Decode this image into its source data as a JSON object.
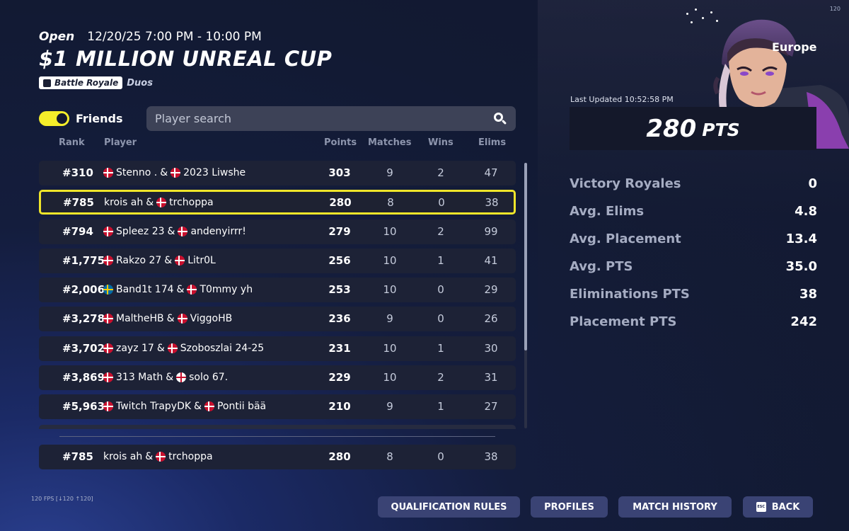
{
  "fps": {
    "top": "120",
    "bottom": "120 FPS [↓120 ↑120]"
  },
  "event": {
    "status": "Open",
    "time": "12/20/25 7:00 PM - 10:00 PM",
    "title": "$1 MILLION UNREAL CUP",
    "mode": "Battle Royale",
    "team": "Duos"
  },
  "filters": {
    "friends_label": "Friends",
    "friends_on": true,
    "search_placeholder": "Player search"
  },
  "columns": {
    "rank": "Rank",
    "player": "Player",
    "points": "Points",
    "matches": "Matches",
    "wins": "Wins",
    "elims": "Elims"
  },
  "rows": [
    {
      "rank": "#310",
      "p1": "Stenno .",
      "f1": "dk",
      "p2": "2023 Liwshe",
      "f2": "dk",
      "points": "303",
      "matches": "9",
      "wins": "2",
      "elims": "47"
    },
    {
      "rank": "#785",
      "p1": "krois ah",
      "f1": "",
      "p2": "trchoppa",
      "f2": "dk",
      "points": "280",
      "matches": "8",
      "wins": "0",
      "elims": "38",
      "highlight": true
    },
    {
      "rank": "#794",
      "p1": "Spleez 23",
      "f1": "dk",
      "p2": "andenyirrr!",
      "f2": "dk",
      "points": "279",
      "matches": "10",
      "wins": "2",
      "elims": "99"
    },
    {
      "rank": "#1,775",
      "p1": "Rakzo 27",
      "f1": "dk",
      "p2": "Litr0L",
      "f2": "dk",
      "points": "256",
      "matches": "10",
      "wins": "1",
      "elims": "41"
    },
    {
      "rank": "#2,006",
      "p1": "Band1t 174",
      "f1": "se",
      "p2": "T0mmy yh",
      "f2": "dk",
      "points": "253",
      "matches": "10",
      "wins": "0",
      "elims": "29"
    },
    {
      "rank": "#3,278",
      "p1": "MaltheHB",
      "f1": "dk",
      "p2": "ViggoHB",
      "f2": "dk",
      "points": "236",
      "matches": "9",
      "wins": "0",
      "elims": "26"
    },
    {
      "rank": "#3,702",
      "p1": "zayz 17",
      "f1": "dk",
      "p2": "Szoboszlai 24-25",
      "f2": "dk",
      "points": "231",
      "matches": "10",
      "wins": "1",
      "elims": "30"
    },
    {
      "rank": "#3,869",
      "p1": "313 Math",
      "f1": "dk",
      "p2": "solo 67.",
      "f2": "en",
      "points": "229",
      "matches": "10",
      "wins": "2",
      "elims": "31"
    },
    {
      "rank": "#5,963",
      "p1": "Twitch TrapyDK",
      "f1": "dk",
      "p2": "Pontii bää",
      "f2": "dk",
      "points": "210",
      "matches": "9",
      "wins": "1",
      "elims": "27"
    }
  ],
  "pinned": {
    "rank": "#785",
    "p1": "krois ah",
    "f1": "",
    "p2": "trchoppa",
    "f2": "dk",
    "points": "280",
    "matches": "8",
    "wins": "0",
    "elims": "38"
  },
  "panel": {
    "region": "Europe",
    "last_updated": "Last Updated 10:52:58 PM",
    "points": "280",
    "points_unit": "PTS",
    "stats": [
      {
        "label": "Victory Royales",
        "value": "0"
      },
      {
        "label": "Avg. Elims",
        "value": "4.8"
      },
      {
        "label": "Avg. Placement",
        "value": "13.4"
      },
      {
        "label": "Avg. PTS",
        "value": "35.0"
      },
      {
        "label": "Eliminations PTS",
        "value": "38"
      },
      {
        "label": "Placement PTS",
        "value": "242"
      }
    ]
  },
  "buttons": {
    "qualification": "QUALIFICATION RULES",
    "profiles": "PROFILES",
    "history": "MATCH HISTORY",
    "back": "BACK",
    "esc": "ESC"
  }
}
